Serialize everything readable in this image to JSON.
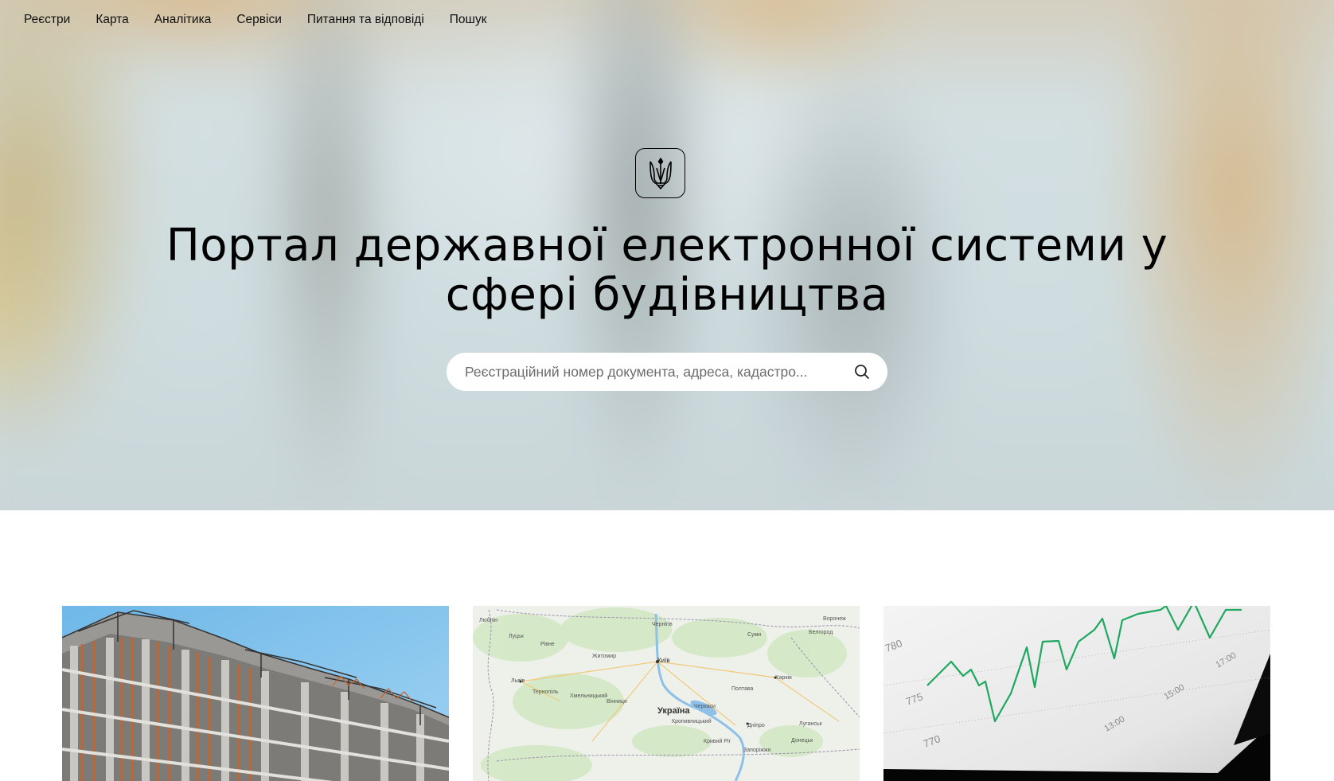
{
  "nav": {
    "items": [
      {
        "label": "Реєстри"
      },
      {
        "label": "Карта"
      },
      {
        "label": "Аналітика"
      },
      {
        "label": "Сервіси"
      },
      {
        "label": "Питання та відповіді"
      },
      {
        "label": "Пошук"
      }
    ]
  },
  "hero": {
    "emblem_icon": "trident-icon",
    "title_line1": "Портал державної електронної системи у",
    "title_line2": "сфері будівництва",
    "search": {
      "placeholder": "Реєстраційний номер документа, адреса, кадастро...",
      "icon": "search-icon"
    }
  },
  "cards": {
    "map": {
      "labels": {
        "country": "Україна",
        "cities": [
          "Луцьк",
          "Рівне",
          "Житомир",
          "Київ",
          "Чернігів",
          "Суми",
          "Харків",
          "Полтава",
          "Луганськ",
          "Донецьк",
          "Дніпро",
          "Запоріжжя",
          "Кривий Ріг",
          "Вінниця",
          "Львів",
          "Тернопіль",
          "Хмельницький",
          "Черкаси",
          "Кропивницький",
          "Воронеж",
          "Люблін"
        ]
      }
    },
    "chart": {
      "ticks_y": [
        "780",
        "775",
        "770"
      ],
      "ticks_x": [
        "13:00",
        "15:00",
        "17:00"
      ],
      "line_color": "#1ea860"
    }
  }
}
